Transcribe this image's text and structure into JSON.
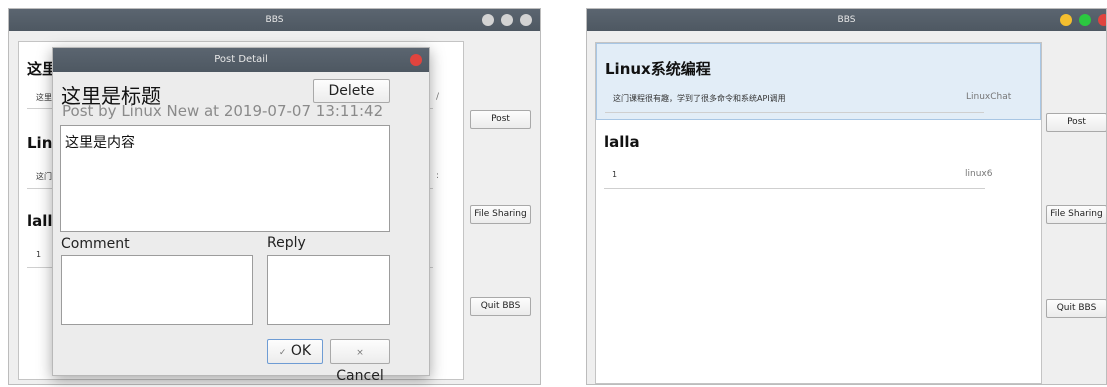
{
  "left_window": {
    "title": "BBS",
    "posts": [
      {
        "title": "这里",
        "content": "这里",
        "trailing": "/"
      },
      {
        "title": "Linu",
        "content": "这门",
        "trailing": ":"
      },
      {
        "title": "lalla",
        "content": "1"
      }
    ],
    "buttons": {
      "post": "Post",
      "file_sharing": "File Sharing",
      "quit": "Quit BBS"
    },
    "dot_colors": [
      "#d3d3d3",
      "#d3d3d3",
      "#d3d3d3"
    ]
  },
  "dialog": {
    "window_title": "Post Detail",
    "title": "这里是标题",
    "subtitle": "Post by Linux New at 2019-07-07 13:11:42",
    "content": "这里是内容",
    "delete_label": "Delete",
    "comment_label": "Comment",
    "reply_label": "Reply",
    "ok_label": "OK",
    "cancel_label": "Cancel",
    "close_color": "#e0443e"
  },
  "right_window": {
    "title": "BBS",
    "posts": [
      {
        "title": "Linux系统编程",
        "content": "这门课程很有趣，学到了很多命令和系统API调用",
        "author": "LinuxChat",
        "selected": true
      },
      {
        "title": "lalla",
        "content": "1",
        "author": "linux6",
        "selected": false
      }
    ],
    "buttons": {
      "post": "Post",
      "file_sharing": "File Sharing",
      "quit": "Quit BBS"
    },
    "dot_colors": [
      "#f5bf2f",
      "#2bc840",
      "#e0443e"
    ],
    "selection_color": "#e2edf7"
  }
}
